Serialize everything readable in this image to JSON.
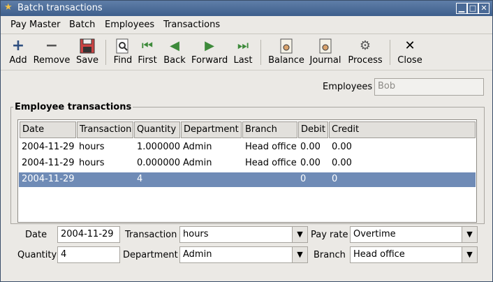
{
  "window": {
    "title": "Batch transactions"
  },
  "menu": [
    "Pay Master",
    "Batch",
    "Employees",
    "Transactions"
  ],
  "toolbar": {
    "add": "Add",
    "remove": "Remove",
    "save": "Save",
    "find": "Find",
    "first": "First",
    "back": "Back",
    "forward": "Forward",
    "last": "Last",
    "balance": "Balance",
    "journal": "Journal",
    "process": "Process",
    "close": "Close"
  },
  "employees": {
    "label": "Employees",
    "value": "Bob"
  },
  "frame": {
    "title": "Employee transactions"
  },
  "table": {
    "columns": [
      "Date",
      "Transaction",
      "Quantity",
      "Department",
      "Branch",
      "Debit",
      "Credit"
    ],
    "rows": [
      [
        "2004-11-29",
        "hours",
        "1.000000",
        "Admin",
        "Head office",
        "0.00",
        "0.00"
      ],
      [
        "2004-11-29",
        "hours",
        "0.000000",
        "Admin",
        "Head office",
        "0.00",
        "0.00"
      ],
      [
        "2004-11-29",
        "",
        "4",
        "",
        "",
        "0",
        "0"
      ]
    ]
  },
  "form": {
    "date_label": "Date",
    "date_value": "2004-11-29",
    "transaction_label": "Transaction",
    "transaction_value": "hours",
    "payrate_label": "Pay rate",
    "payrate_value": "Overtime",
    "quantity_label": "Quantity",
    "quantity_value": "4",
    "department_label": "Department",
    "department_value": "Admin",
    "branch_label": "Branch",
    "branch_value": "Head office"
  }
}
